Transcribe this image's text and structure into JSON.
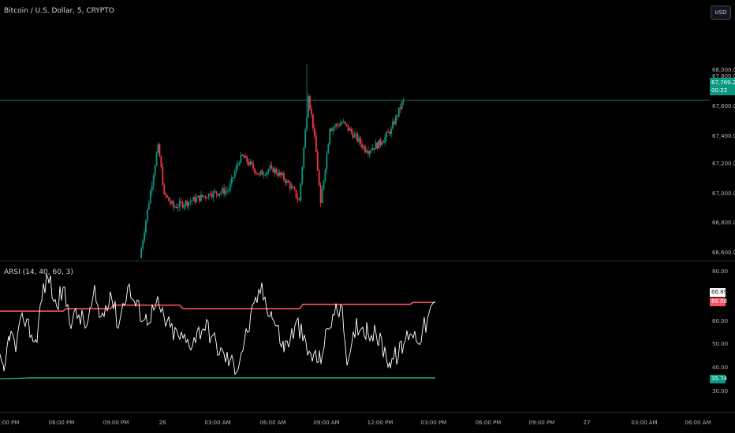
{
  "colors": {
    "background": "#000000",
    "up": "#089981",
    "down": "#f23645",
    "rsi_line": "#ffffff",
    "upper_band": "#f7525f",
    "lower_band": "#22ab94",
    "price_line": "#1e5c4f"
  },
  "header": {
    "symbol_title": "Bitcoin / U.S. Dollar, 5, CRYPTO",
    "currency_button": "USD"
  },
  "price_axis": {
    "ticks": [
      "68,000.00",
      "67,800.00",
      "67,600.00",
      "67,400.00",
      "67,200.00",
      "67,000.00",
      "66,800.00",
      "66,600.00"
    ],
    "tick_values": [
      68000,
      67800,
      67600,
      67400,
      67200,
      67000,
      66800,
      66600
    ],
    "last_price": "67,769.22",
    "countdown": "00:22"
  },
  "oscillator": {
    "legend": "ARSI (14, 40, 60, 3)",
    "ticks": [
      "80.00",
      "70.00",
      "60.00",
      "50.00",
      "40.00",
      "30.00"
    ],
    "tick_values": [
      80,
      70,
      60,
      50,
      40,
      30
    ],
    "rsi_value": "66.89",
    "upper_value": "66.08",
    "lower_value": "35.74"
  },
  "time_axis": {
    "ticks": [
      "03:00 PM",
      "06:00 PM",
      "09:00 PM",
      "26",
      "03:00 AM",
      "06:00 AM",
      "09:00 AM",
      "12:00 PM",
      "03:00 PM",
      "06:00 PM",
      "09:00 PM",
      "27",
      "03:00 AM",
      "06:00 AM"
    ]
  },
  "chart_data": [
    {
      "type": "candlestick",
      "title": "Bitcoin / U.S. Dollar, 5, CRYPTO",
      "ylim": [
        66560,
        68100
      ],
      "key_points": [
        {
          "x": "03:00 PM (25th)",
          "close": 66560
        },
        {
          "x": "~05:30 PM",
          "close": 67450
        },
        {
          "x": "~06:30 PM",
          "close": 66950
        },
        {
          "x": "~10:00 PM",
          "close": 67050
        },
        {
          "x": "~02:00 AM",
          "close": 67400
        },
        {
          "x": "~05:30 AM",
          "close": 67100
        },
        {
          "x": "~09:00 AM",
          "high": 68050
        },
        {
          "x": "~10:00 AM",
          "low": 66950
        },
        {
          "x": "~11:00 AM",
          "close": 67650
        },
        {
          "x": "~02:00 PM",
          "close": 67400
        },
        {
          "x": "~03:30 PM",
          "close": 67769.22
        }
      ]
    },
    {
      "type": "line",
      "title": "ARSI (14, 40, 60, 3)",
      "ylim": [
        25,
        85
      ],
      "series": [
        {
          "name": "ARSI",
          "last": 66.89
        },
        {
          "name": "upper",
          "last": 66.08
        },
        {
          "name": "lower",
          "last": 35.74
        }
      ]
    }
  ]
}
